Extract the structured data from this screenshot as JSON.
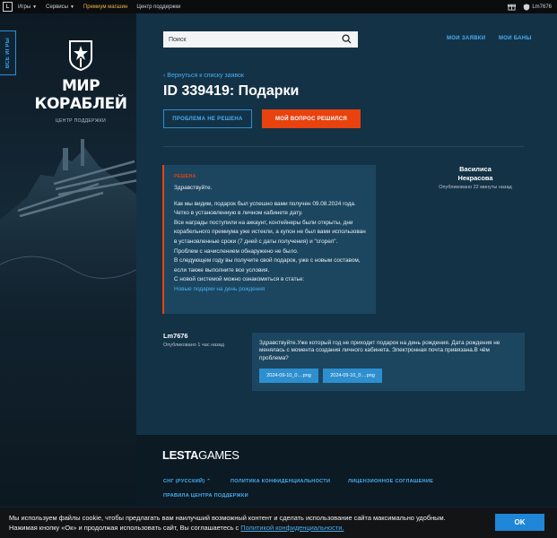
{
  "topbar": {
    "logo": "L",
    "items": [
      "Игры",
      "Сервисы",
      "Премиум магазин",
      "Центр поддержки"
    ],
    "user": "Lm7676"
  },
  "side_tab": "ВСЕ ИГРЫ",
  "brand": {
    "title": "МИР КОРАБЛЕЙ",
    "subtitle": "ЦЕНТР ПОДДЕРЖКИ"
  },
  "search": {
    "placeholder": "Поиск"
  },
  "header_links": {
    "my_requests": "МОИ ЗАЯВКИ",
    "my_bans": "МОИ БАНЫ"
  },
  "ticket": {
    "back": "Вернуться к списку заявок",
    "title": "ID 339419: Подарки",
    "btn_not_solved": "ПРОБЛЕМА НЕ РЕШЕНА",
    "btn_solved": "МОЙ ВОПРОС РЕШИЛСЯ"
  },
  "answer": {
    "status": "РЕШЕНА",
    "greeting": "Здравствуйте.",
    "p1": "Как мы видим, подарок был успешно вами получен 09.08.2024 года. Четко в установленную в личном кабинете дату.",
    "p2": "Все награды поступили на аккаунт, контейнеры были открыты, дни корабельного премиума уже истекли, а купон не был вами использован в установленные сроки (7 дней с даты получения) и \"сгорел\".",
    "p3": "Проблем с начислением обнаружено не было.",
    "p4": "В следующем году вы получите свой подарок, уже с новым составом, если также выполните все условия.",
    "p5": "С новой системой можно ознакомиться в статье:",
    "link": "Новые подарки на день рождения",
    "author_first": "Василиса",
    "author_last": "Некрасова",
    "published": "Опубликовано 22 минуты назад"
  },
  "question": {
    "author": "Lm7676",
    "published": "Опубликовано 1 час назад",
    "text": "Здравствуйте.Уже который год не приходит подарок на день рождения. Дата рождения не менялась с момента создания личного кабинета. Электронная почта привязана.В чём проблема?",
    "attachments": [
      "2024-09-10_0....png",
      "2024-09-10_0....png"
    ]
  },
  "footer": {
    "logo_bold": "LESTA",
    "logo_light": "GAMES",
    "region": "СНГ (РУССКИЙ)",
    "privacy": "ПОЛИТИКА КОНФИДЕНЦИАЛЬНОСТИ",
    "license": "ЛИЦЕНЗИОННОЕ СОГЛАШЕНИЕ",
    "rules": "ПРАВИЛА ЦЕНТРА ПОДДЕРЖКИ"
  },
  "cookie": {
    "text": "Мы используем файлы cookie, чтобы предлагать вам наилучший возможный контент и сделать использование сайта максимально удобным. Нажимая кнопку «Ок» и продолжая использовать сайт, Вы соглашаетесь с",
    "link": "Политикой конфиденциальности.",
    "ok": "OK"
  },
  "colors": {
    "accent": "#47aef2",
    "primary_button": "#e8420f",
    "ok_button": "#1f86d8",
    "card": "#1c4660"
  }
}
